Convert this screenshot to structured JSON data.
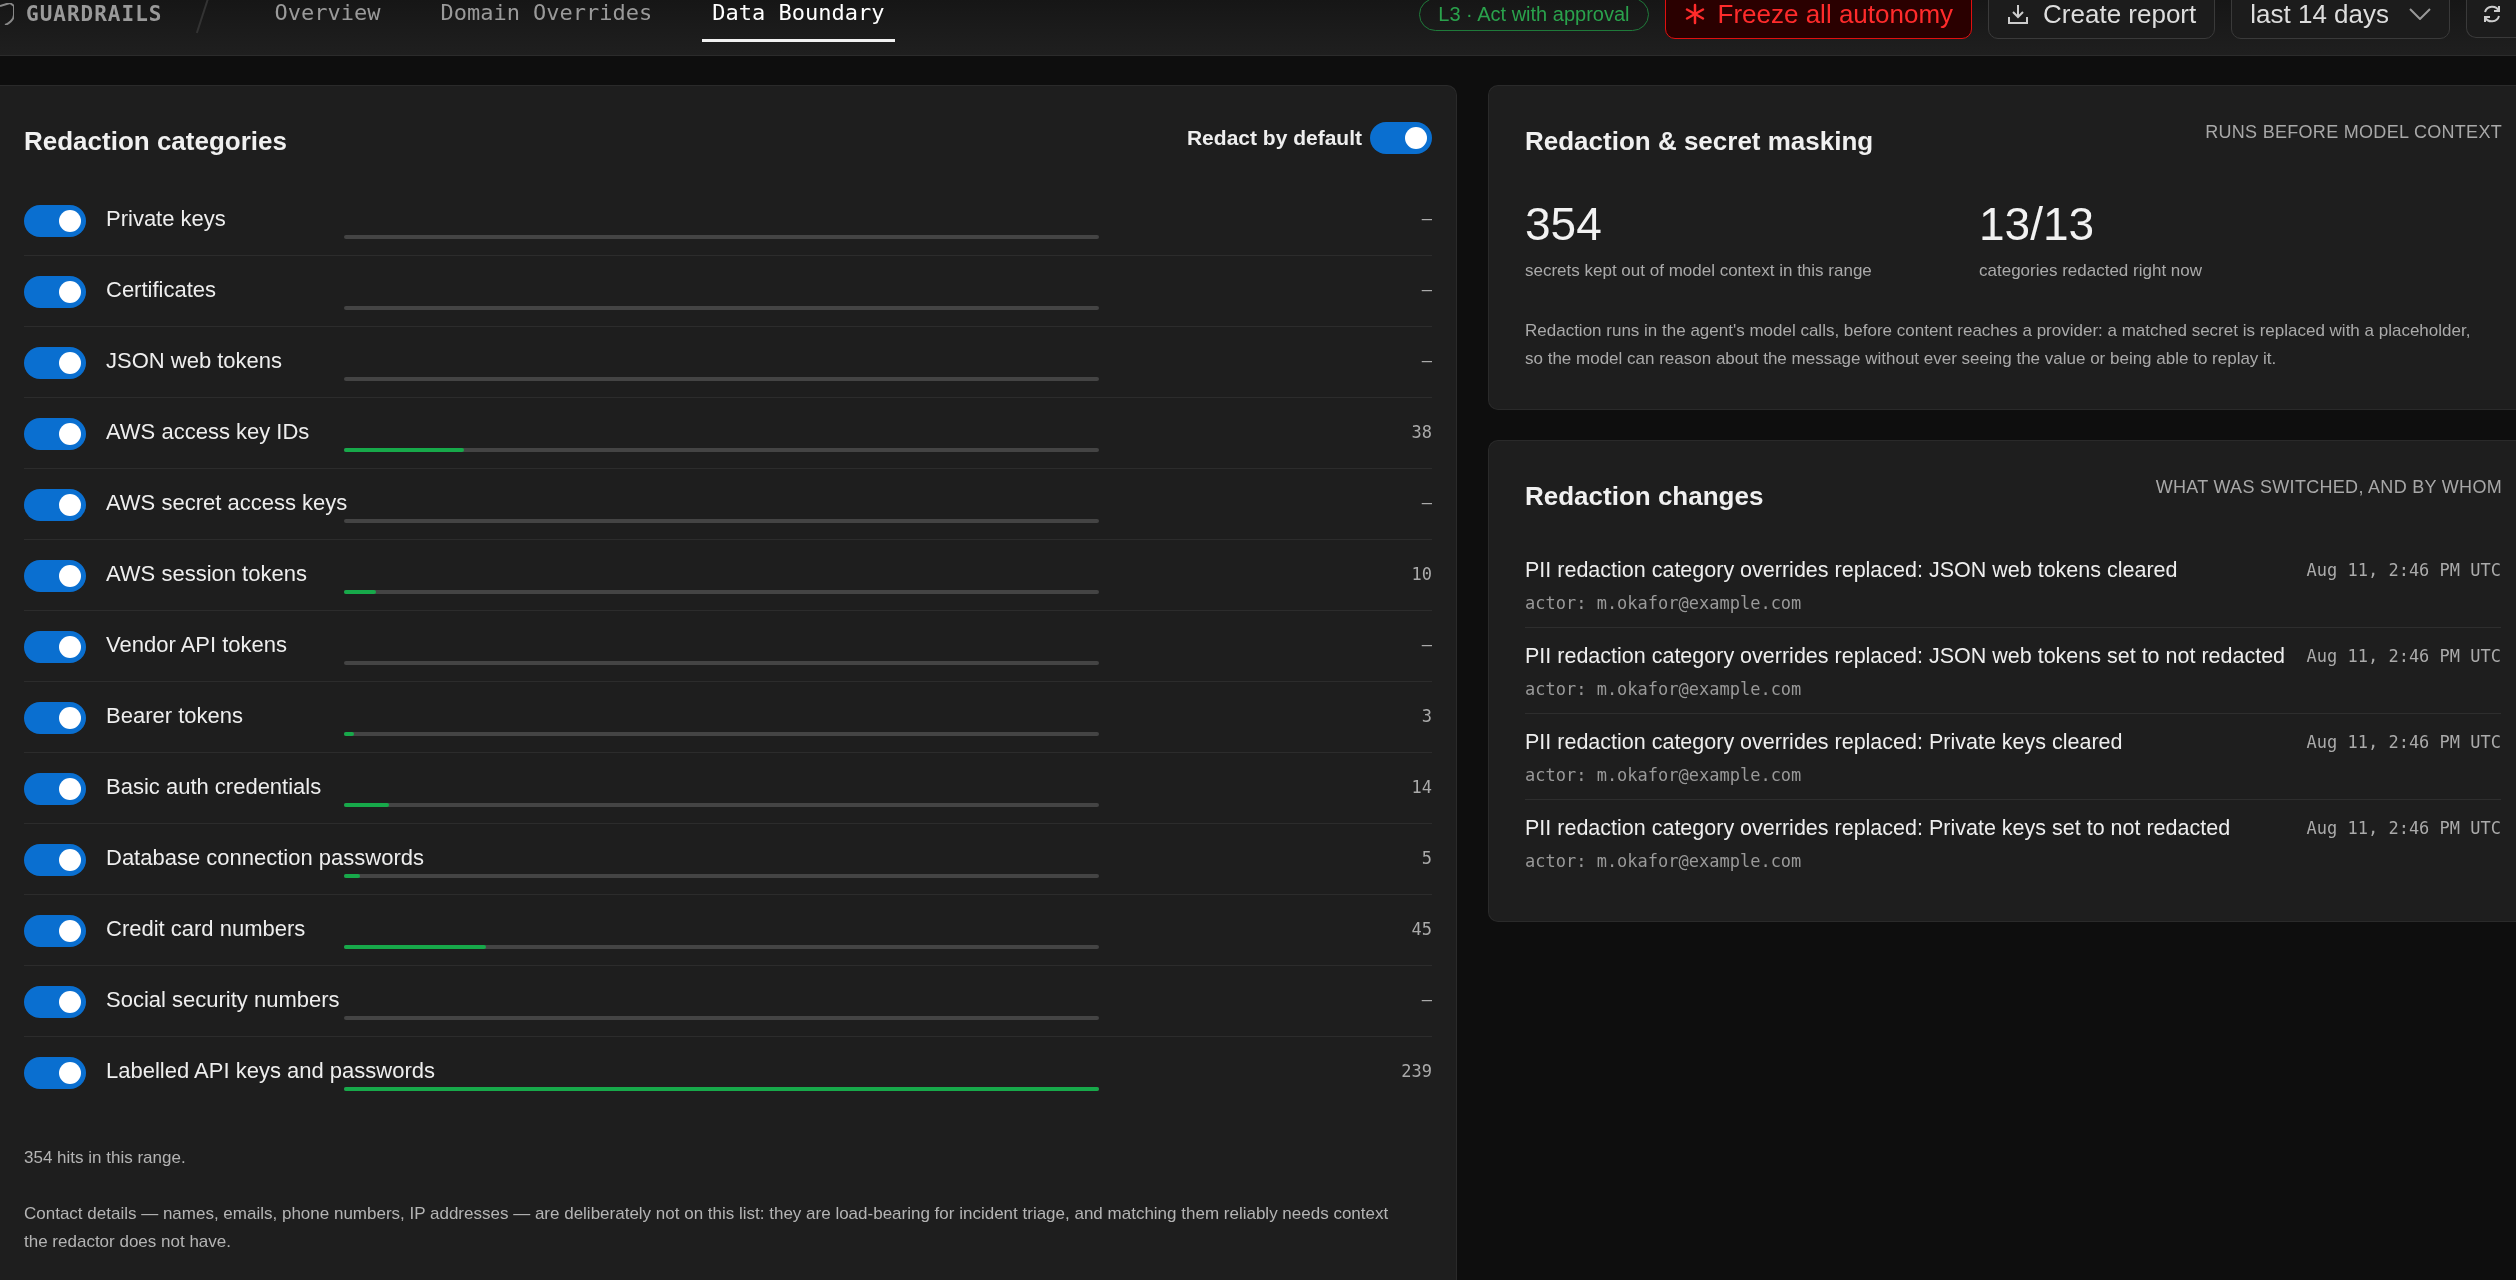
{
  "header": {
    "brand": "GUARDRAILS",
    "tabs": [
      {
        "label": "Overview",
        "selected": false
      },
      {
        "label": "Domain Overrides",
        "selected": false
      },
      {
        "label": "Data Boundary",
        "selected": true
      }
    ],
    "autonomy_badge": "L3 · Act with approval",
    "freeze_button": "Freeze all autonomy",
    "report_button": "Create report",
    "range_select": "last 14 days"
  },
  "categories_panel": {
    "title": "Redaction categories",
    "default_toggle": {
      "label": "Redact by default",
      "on": true
    },
    "categories": [
      {
        "name": "Private keys",
        "on": true,
        "level": 0,
        "count": "–"
      },
      {
        "name": "Certificates",
        "on": true,
        "level": 0,
        "count": "–"
      },
      {
        "name": "JSON web tokens",
        "on": true,
        "level": 0,
        "count": "–"
      },
      {
        "name": "AWS access key IDs",
        "on": true,
        "level": 0.159,
        "count": "38"
      },
      {
        "name": "AWS secret access keys",
        "on": true,
        "level": 0,
        "count": "–"
      },
      {
        "name": "AWS session tokens",
        "on": true,
        "level": 0.042,
        "count": "10"
      },
      {
        "name": "Vendor API tokens",
        "on": true,
        "level": 0,
        "count": "–"
      },
      {
        "name": "Bearer tokens",
        "on": true,
        "level": 0.013,
        "count": "3"
      },
      {
        "name": "Basic auth credentials",
        "on": true,
        "level": 0.059,
        "count": "14"
      },
      {
        "name": "Database connection passwords",
        "on": true,
        "level": 0.021,
        "count": "5"
      },
      {
        "name": "Credit card numbers",
        "on": true,
        "level": 0.188,
        "count": "45"
      },
      {
        "name": "Social security numbers",
        "on": true,
        "level": 0,
        "count": "–"
      },
      {
        "name": "Labelled API keys and passwords",
        "on": true,
        "level": 1,
        "count": "239"
      }
    ],
    "hits_note": "354 hits in this range.",
    "footnote": "Contact details — names, emails, phone numbers, IP addresses — are deliberately not on this list: they are load-bearing for incident triage, and matching them reliably needs context the redactor does not have."
  },
  "masking_panel": {
    "title": "Redaction & secret masking",
    "eyebrow": "RUNS BEFORE MODEL CONTEXT",
    "stats": [
      {
        "value": "354",
        "label": "secrets kept out of model context in this range"
      },
      {
        "value": "13/13",
        "label": "categories redacted right now"
      }
    ],
    "description": "Redaction runs in the agent's model calls, before content reaches a provider: a matched secret is replaced with a placeholder, so the model can reason about the message without ever seeing the value or being able to replay it."
  },
  "changes_panel": {
    "title": "Redaction changes",
    "eyebrow": "WHAT WAS SWITCHED, AND BY WHOM",
    "changes": [
      {
        "text": "PII redaction category overrides replaced: JSON web tokens cleared",
        "time": "Aug 11, 2:46 PM UTC",
        "actor": "actor: m.okafor@example.com"
      },
      {
        "text": "PII redaction category overrides replaced: JSON web tokens set to not redacted",
        "time": "Aug 11, 2:46 PM UTC",
        "actor": "actor: m.okafor@example.com"
      },
      {
        "text": "PII redaction category overrides replaced: Private keys cleared",
        "time": "Aug 11, 2:46 PM UTC",
        "actor": "actor: m.okafor@example.com"
      },
      {
        "text": "PII redaction category overrides replaced: Private keys set to not redacted",
        "time": "Aug 11, 2:46 PM UTC",
        "actor": "actor: m.okafor@example.com"
      }
    ]
  }
}
